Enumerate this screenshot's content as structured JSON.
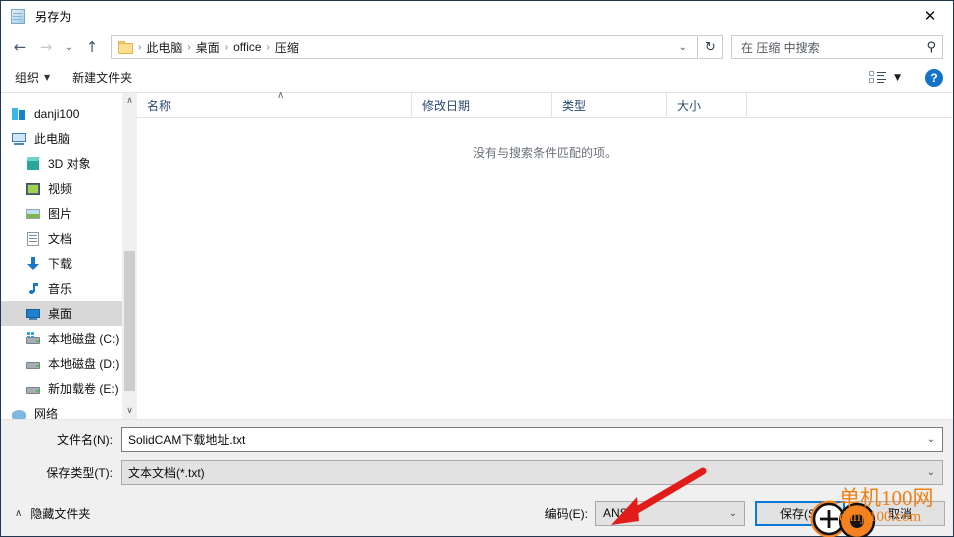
{
  "window": {
    "title": "另存为",
    "icon": "notepad-icon",
    "close_label": "✕"
  },
  "nav": {
    "back_label": "←",
    "forward_label": "→",
    "recent_label": "⌄",
    "up_label": "↑",
    "breadcrumb": [
      "此电脑",
      "桌面",
      "office",
      "压缩"
    ],
    "breadcrumb_separator": "›",
    "path_dropdown": "⌄",
    "refresh_label": "↻"
  },
  "search": {
    "placeholder": "在 压缩 中搜索",
    "icon": "search-icon"
  },
  "command_bar": {
    "organize_label": "组织",
    "organize_caret": "▼",
    "new_folder_label": "新建文件夹",
    "view_caret": "▼",
    "help_label": "?"
  },
  "sidebar": {
    "items": [
      {
        "label": "danji100",
        "icon": "danji-folder-icon",
        "indent": false,
        "selected": false
      },
      {
        "label": "此电脑",
        "icon": "this-pc-icon",
        "indent": false,
        "selected": false
      },
      {
        "label": "3D 对象",
        "icon": "3d-objects-icon",
        "indent": true,
        "selected": false
      },
      {
        "label": "视频",
        "icon": "videos-icon",
        "indent": true,
        "selected": false
      },
      {
        "label": "图片",
        "icon": "pictures-icon",
        "indent": true,
        "selected": false
      },
      {
        "label": "文档",
        "icon": "documents-icon",
        "indent": true,
        "selected": false
      },
      {
        "label": "下载",
        "icon": "downloads-icon",
        "indent": true,
        "selected": false
      },
      {
        "label": "音乐",
        "icon": "music-icon",
        "indent": true,
        "selected": false
      },
      {
        "label": "桌面",
        "icon": "desktop-icon",
        "indent": true,
        "selected": true
      },
      {
        "label": "本地磁盘 (C:)",
        "icon": "system-drive-icon",
        "indent": true,
        "selected": false
      },
      {
        "label": "本地磁盘 (D:)",
        "icon": "drive-icon",
        "indent": true,
        "selected": false
      },
      {
        "label": "新加载卷 (E:)",
        "icon": "drive-icon",
        "indent": true,
        "selected": false
      },
      {
        "label": "网络",
        "icon": "network-icon",
        "indent": false,
        "selected": false
      }
    ],
    "scroll_up": "∧",
    "scroll_down": "∨"
  },
  "file_list": {
    "columns": [
      "名称",
      "修改日期",
      "类型",
      "大小"
    ],
    "sort_indicator": "∧",
    "rows": [],
    "empty_message": "没有与搜索条件匹配的项。"
  },
  "form": {
    "filename_label": "文件名(N):",
    "filename_value": "SolidCAM下载地址.txt",
    "filetype_label": "保存类型(T):",
    "filetype_value": "文本文档(*.txt)",
    "dropdown_arrow": "⌄"
  },
  "footer": {
    "hide_folders_label": "隐藏文件夹",
    "hide_folders_caret": "∧",
    "encoding_label": "编码(E):",
    "encoding_value": "ANSI",
    "save_label": "保存(S)",
    "cancel_label": "取消"
  },
  "watermark": {
    "line1": "单机100网",
    "line2": "danji100.com",
    "color": "#f07f15"
  },
  "annotations": {
    "arrow_color": "#e21b1b",
    "cursor_ring_color": "#f58220",
    "click_dot_color": "#f58220"
  }
}
